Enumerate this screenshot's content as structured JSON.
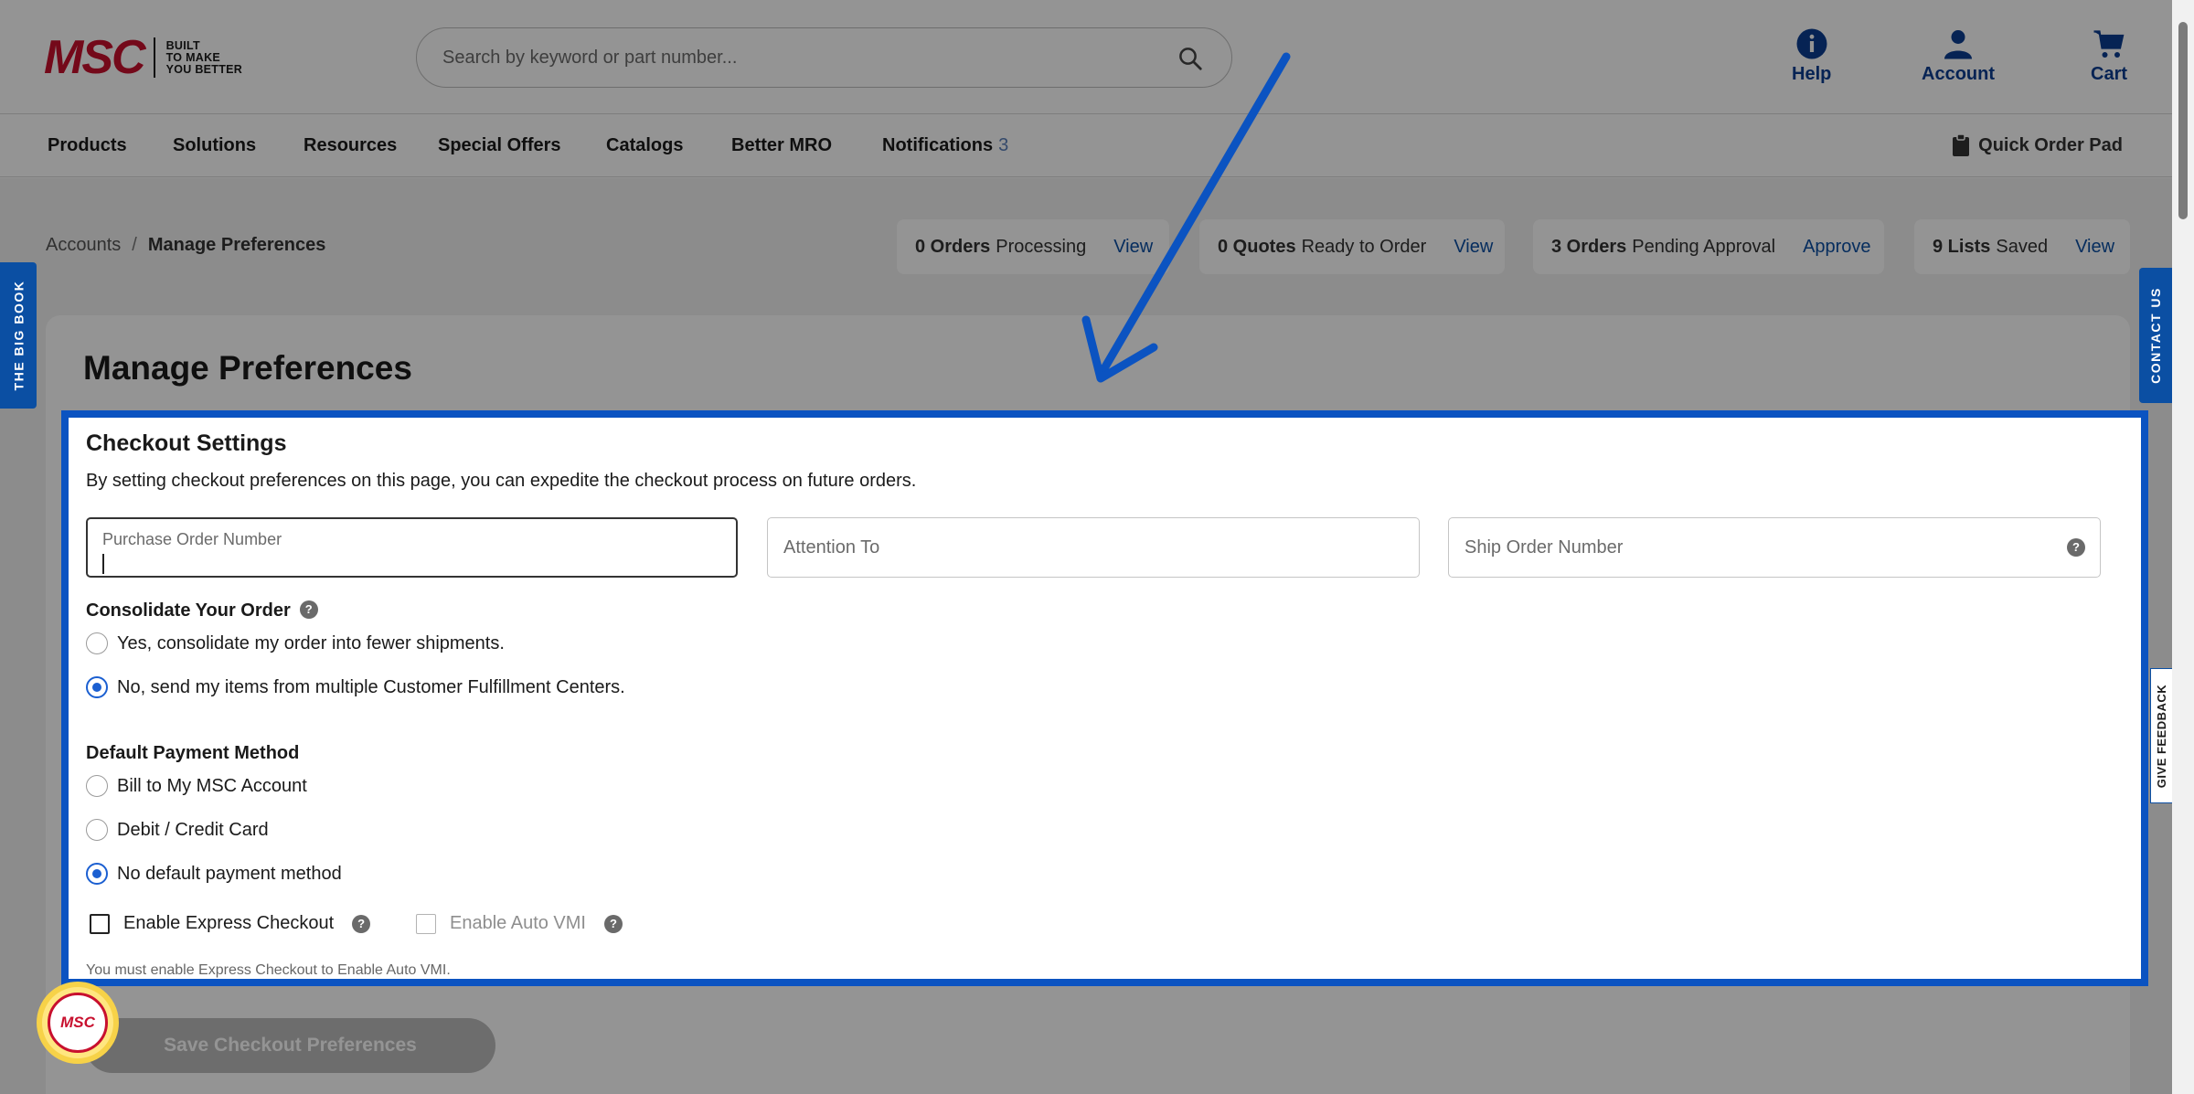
{
  "header": {
    "logo": "MSC",
    "tagline": [
      "BUILT",
      "TO MAKE",
      "YOU BETTER"
    ],
    "search_placeholder": "Search by keyword or part number...",
    "help_label": "Help",
    "account_label": "Account",
    "cart_label": "Cart"
  },
  "nav": {
    "items": [
      "Products",
      "Solutions",
      "Resources",
      "Special Offers",
      "Catalogs",
      "Better MRO",
      "Notifications"
    ],
    "notifications_count": "3",
    "quick_order": "Quick Order Pad"
  },
  "breadcrumb": {
    "parent": "Accounts",
    "separator": "/",
    "current": "Manage Preferences"
  },
  "stats": [
    {
      "count": "0 Orders",
      "text": "Processing",
      "action": "View"
    },
    {
      "count": "0 Quotes",
      "text": "Ready to Order",
      "action": "View"
    },
    {
      "count": "3 Orders",
      "text": "Pending Approval",
      "action": "Approve"
    },
    {
      "count": "9 Lists",
      "text": "Saved",
      "action": "View"
    }
  ],
  "page_title": "Manage Preferences",
  "checkout": {
    "title": "Checkout Settings",
    "description": "By setting checkout preferences on this page, you can expedite the checkout process on future orders.",
    "po_label": "Purchase Order Number",
    "attention_placeholder": "Attention To",
    "ship_placeholder": "Ship Order Number",
    "consolidate_label": "Consolidate Your Order",
    "consolidate_options": [
      "Yes, consolidate my order into fewer shipments.",
      "No, send my items from multiple Customer Fulfillment Centers."
    ],
    "consolidate_selected": 1,
    "payment_label": "Default Payment Method",
    "payment_options": [
      "Bill to My MSC Account",
      "Debit / Credit Card",
      "No default payment method"
    ],
    "payment_selected": 2,
    "express_label": "Enable Express Checkout",
    "auto_vmi_label": "Enable Auto VMI",
    "note": "You must enable Express Checkout to Enable Auto VMI.",
    "help_glyph": "?"
  },
  "save_button": "Save Checkout Preferences",
  "badge": "MSC",
  "side_tabs": {
    "big_book": "THE BIG BOOK",
    "contact": "CONTACT US",
    "feedback": "GIVE FEEDBACK"
  },
  "colors": {
    "brand_red": "#c8102e",
    "link_blue": "#0b4fa3",
    "highlight": "#0b53c1",
    "radio_blue": "#1b5fd1"
  }
}
